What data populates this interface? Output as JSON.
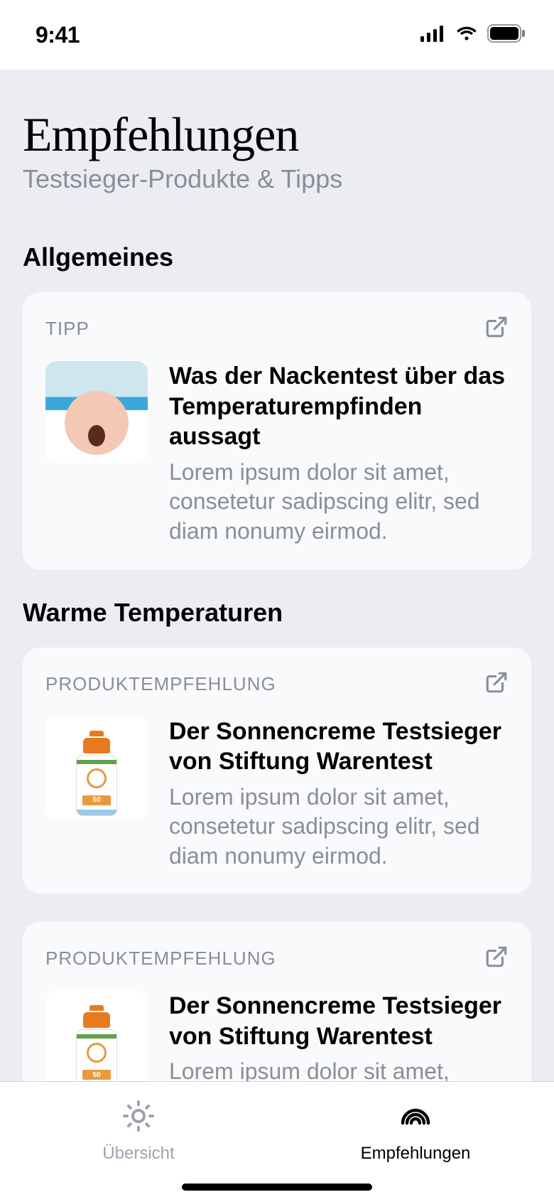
{
  "status": {
    "time": "9:41"
  },
  "header": {
    "title": "Empfehlungen",
    "subtitle": "Testsieger-Produkte & Tipps"
  },
  "sections": [
    {
      "heading": "Allgemeines",
      "cards": [
        {
          "type_label": "TIPP",
          "title": "Was der Nackentest über das Temperaturempfinden aussagt",
          "description": "Lorem ipsum dolor sit amet, consetetur sadipscing elitr, sed diam nonumy eirmod.",
          "image_kind": "baby"
        }
      ]
    },
    {
      "heading": "Warme Temperaturen",
      "cards": [
        {
          "type_label": "PRODUKTEMPFEHLUNG",
          "title": "Der Sonnencreme Testsieger von Stiftung Warentest",
          "description": "Lorem ipsum dolor sit amet, consetetur sadipscing elitr, sed diam nonumy eirmod.",
          "image_kind": "sunscreen"
        },
        {
          "type_label": "PRODUKTEMPFEHLUNG",
          "title": "Der Sonnencreme Testsieger von Stiftung Warentest",
          "description": "Lorem ipsum dolor sit amet, consetetur sadipscing elitr,",
          "image_kind": "sunscreen"
        }
      ]
    }
  ],
  "tabs": {
    "overview_label": "Übersicht",
    "recommendations_label": "Empfehlungen"
  }
}
